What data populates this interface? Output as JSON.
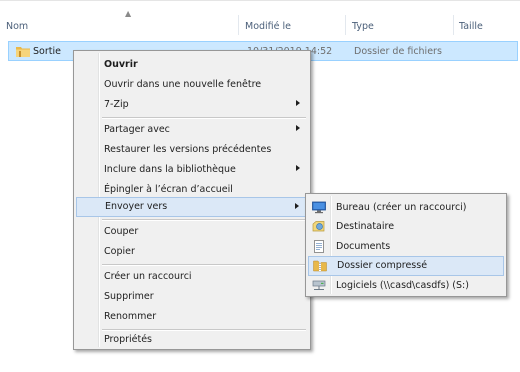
{
  "columns": {
    "name": "Nom",
    "modified": "Modifié le",
    "type": "Type",
    "size": "Taille"
  },
  "file": {
    "name": "Sortie",
    "modified_partial": "10/31/2019 14:52",
    "type": "Dossier de fichiers",
    "icon": "folder-icon"
  },
  "context_menu": {
    "items": [
      {
        "label": "Ouvrir",
        "bold": true
      },
      {
        "label": "Ouvrir dans une nouvelle fenêtre"
      },
      {
        "label": "7-Zip",
        "submenu": true
      },
      {
        "label": "Partager avec",
        "submenu": true
      },
      {
        "label": "Restaurer les versions précédentes"
      },
      {
        "label": "Inclure dans la bibliothèque",
        "submenu": true
      },
      {
        "label": "Épingler à l’écran d’accueil"
      },
      {
        "label": "Envoyer vers",
        "submenu": true,
        "highlighted": true
      },
      {
        "label": "Couper"
      },
      {
        "label": "Copier"
      },
      {
        "label": "Créer un raccourci"
      },
      {
        "label": "Supprimer"
      },
      {
        "label": "Renommer"
      },
      {
        "label": "Propriétés"
      }
    ]
  },
  "send_to_menu": {
    "items": [
      {
        "label": "Bureau (créer un raccourci)",
        "icon": "desktop-icon"
      },
      {
        "label": "Destinataire",
        "icon": "mail-recipient-icon"
      },
      {
        "label": "Documents",
        "icon": "documents-icon"
      },
      {
        "label": "Dossier compressé",
        "icon": "zip-folder-icon",
        "highlighted": true
      },
      {
        "label": "Logiciels (\\\\casd\\casdfs) (S:)",
        "icon": "network-drive-icon"
      }
    ]
  },
  "colors": {
    "selection_bg": "#cce8ff",
    "selection_border": "#99d1ff",
    "menu_bg": "#f0f0f0",
    "menu_highlight": "#dbe8f7",
    "header_text": "#4c607a"
  }
}
